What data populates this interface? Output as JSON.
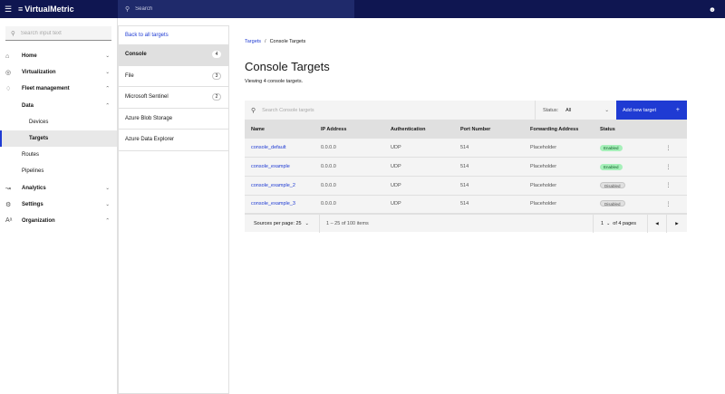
{
  "header": {
    "brand": "VirtualMetric",
    "search_placeholder": "Search"
  },
  "sidebar": {
    "search_placeholder": "Search input text",
    "items": [
      {
        "label": "Home"
      },
      {
        "label": "Virtualization"
      },
      {
        "label": "Fleet management"
      },
      {
        "label": "Data"
      },
      {
        "label": "Devices"
      },
      {
        "label": "Targets"
      },
      {
        "label": "Routes"
      },
      {
        "label": "Pipelines"
      },
      {
        "label": "Analytics"
      },
      {
        "label": "Settings"
      },
      {
        "label": "Organization"
      }
    ]
  },
  "target_types": {
    "back_label": "Back to all targets",
    "items": [
      {
        "label": "Console",
        "count": "4"
      },
      {
        "label": "File",
        "count": "3"
      },
      {
        "label": "Microsoft Sentinel",
        "count": "2"
      },
      {
        "label": "Azure Blob Storage"
      },
      {
        "label": "Azure Data Explorer"
      }
    ]
  },
  "main": {
    "breadcrumb": {
      "root": "Targets",
      "separator": "/",
      "current": "Console Targets"
    },
    "title": "Console Targets",
    "subtitle": "Viewing 4 console targets.",
    "table_search_placeholder": "Search Console targets",
    "status_filter": {
      "label": "Status:",
      "value": "All"
    },
    "add_button": "Add new target",
    "columns": [
      "Name",
      "IP Address",
      "Authentication",
      "Port Number",
      "Forwarding Address",
      "Status"
    ],
    "rows": [
      {
        "name": "console_default",
        "ip": "0.0.0.0",
        "auth": "UDP",
        "port": "514",
        "fwd": "Placeholder",
        "status": "Enabled"
      },
      {
        "name": "console_example",
        "ip": "0.0.0.0",
        "auth": "UDP",
        "port": "514",
        "fwd": "Placeholder",
        "status": "Enabled"
      },
      {
        "name": "console_example_2",
        "ip": "0.0.0.0",
        "auth": "UDP",
        "port": "514",
        "fwd": "Placeholder",
        "status": "Disabled"
      },
      {
        "name": "console_example_3",
        "ip": "0.0.0.0",
        "auth": "UDP",
        "port": "514",
        "fwd": "Placeholder",
        "status": "Disabled"
      }
    ],
    "pagination": {
      "per_page_label": "Sources per page: 25",
      "range": "1 – 25 of 100 items",
      "page": "1",
      "of_pages": "of 4 pages"
    }
  },
  "colors": {
    "header_bg": "#0f1651",
    "accent": "#1f3bd3",
    "enabled_badge": "#a7f0ba"
  }
}
